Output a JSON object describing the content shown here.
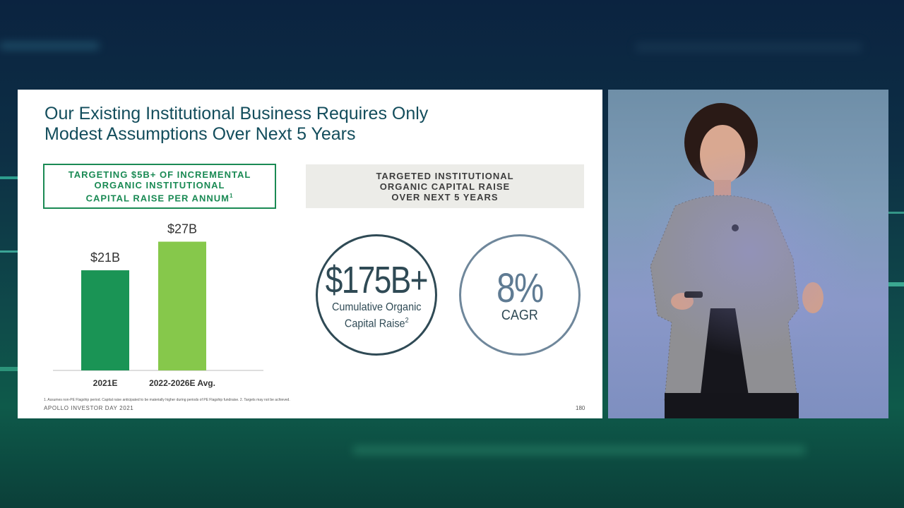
{
  "slide": {
    "title_line1": "Our Existing Institutional Business Requires Only",
    "title_line2": "Modest Assumptions Over Next 5 Years",
    "left_box_line1": "TARGETING $5B+ OF INCREMENTAL",
    "left_box_line2": "ORGANIC INSTITUTIONAL",
    "left_box_line3": "CAPITAL RAISE PER ANNUM",
    "left_box_sup": "1",
    "right_box_line1": "TARGETED INSTITUTIONAL",
    "right_box_line2": "ORGANIC CAPITAL RAISE",
    "right_box_line3": "OVER NEXT 5 YEARS",
    "circle1_value": "$175B+",
    "circle1_label_line1": "Cumulative Organic",
    "circle1_label_line2": "Capital Raise",
    "circle1_sup": "2",
    "circle2_value": "8%",
    "circle2_label": "CAGR",
    "footnote": "1. Assumes non-PE Flagship period. Capital raise anticipated to be materially higher during periods of PE Flagship fundraise. 2. Targets may not be achieved.",
    "footer_brand": "APOLLO INVESTOR DAY 2021",
    "page_number": "180"
  },
  "chart_data": {
    "type": "bar",
    "categories": [
      "2021E",
      "2022-2026E Avg."
    ],
    "values": [
      21,
      27
    ],
    "data_labels": [
      "$21B",
      "$27B"
    ],
    "colors": [
      "#1a9455",
      "#86c84b"
    ],
    "ylim": [
      0,
      30
    ],
    "title": "",
    "xlabel": "",
    "ylabel": ""
  },
  "colors": {
    "title": "#134d5c",
    "accent_green": "#1a8a54",
    "circle_dark": "#2f4a55",
    "circle_slate": "#6f879b"
  }
}
